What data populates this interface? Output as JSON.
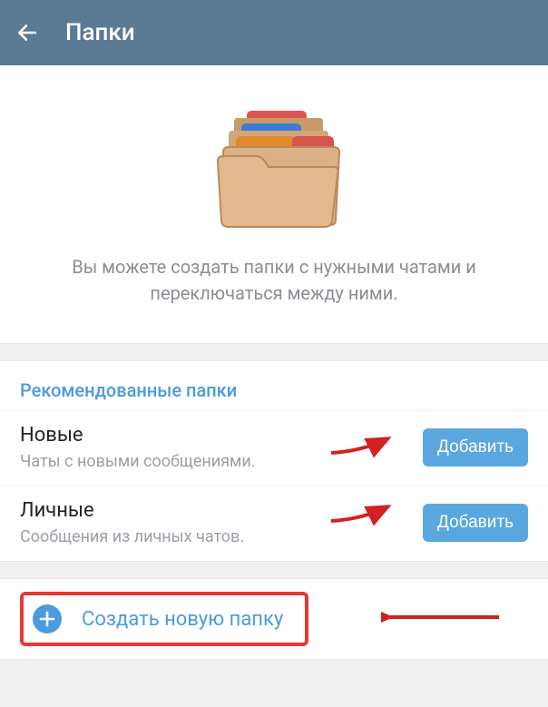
{
  "header": {
    "title": "Папки"
  },
  "hero": {
    "description": "Вы можете создать папки с нужными чатами и переключаться между ними."
  },
  "recommended": {
    "section_title": "Рекомендованные папки",
    "items": [
      {
        "title": "Новые",
        "subtitle": "Чаты с новыми сообщениями.",
        "button": "Добавить"
      },
      {
        "title": "Личные",
        "subtitle": "Сообщения из личных чатов.",
        "button": "Добавить"
      }
    ]
  },
  "create": {
    "label": "Создать новую папку"
  }
}
